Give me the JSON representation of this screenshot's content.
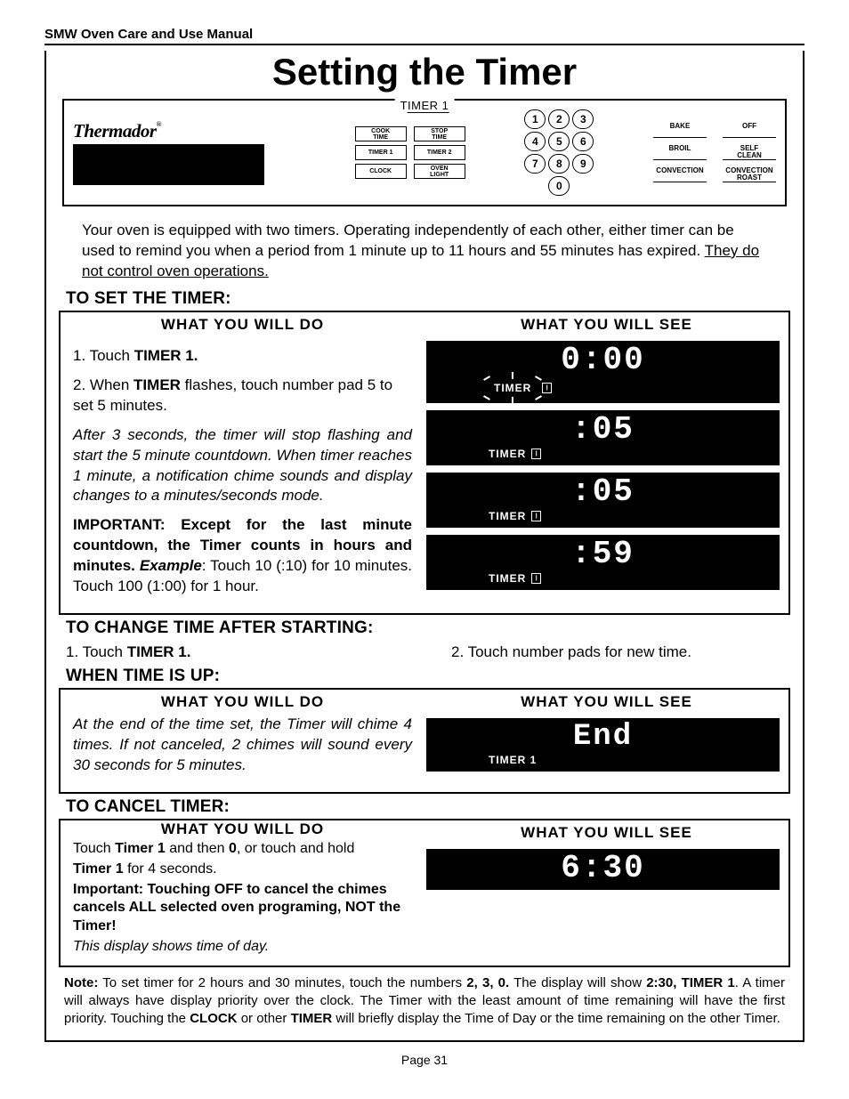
{
  "header": {
    "running": "SMW Oven Care and Use Manual"
  },
  "title": "Setting the Timer",
  "panel": {
    "tab": "TIMER 1",
    "brand": "Thermador",
    "left_buttons": [
      [
        "COOK",
        "TIME"
      ],
      [
        "STOP",
        "TIME"
      ],
      [
        "TIMER 1",
        ""
      ],
      [
        "TIMER 2",
        ""
      ],
      [
        "CLOCK",
        ""
      ],
      [
        "OVEN",
        "LIGHT"
      ]
    ],
    "keypad": [
      "1",
      "2",
      "3",
      "4",
      "5",
      "6",
      "7",
      "8",
      "9",
      "0"
    ],
    "mode_buttons": [
      "BAKE",
      "OFF",
      "BROIL",
      "SELF\nCLEAN",
      "CONVECTION",
      "CONVECTION\nROAST"
    ]
  },
  "intro": {
    "text_a": "Your oven is equipped with two timers.  Operating independently of each other, either timer can be used to remind you when a period from 1 minute up to 11 hours and 55 minutes has expired.  ",
    "text_b": "They do not control oven operations."
  },
  "set": {
    "heading": "TO SET  THE TIMER:",
    "col_do": "WHAT  YOU  WILL  DO",
    "col_see": "WHAT  YOU  WILL  SEE",
    "step1_a": "1.  Touch ",
    "step1_b": "TIMER 1.",
    "step2_a": "2.  When ",
    "step2_b": "TIMER",
    "step2_c": "  flashes, touch number pad 5 to set 5 minutes.",
    "ital": "After 3 seconds, the timer will stop flashing and start the 5 minute countdown.   When timer reaches 1 minute, a notification chime sounds and display changes to a minutes/seconds mode.",
    "imp_lead": "IMPORTANT:  Except for the last minute countdown, the Timer counts in hours and minutes. ",
    "imp_ex_lbl": "Example",
    "imp_tail": ": Touch 10 (:10) for 10 minutes. Touch 100 (1:00) for 1 hour.",
    "lcd": [
      {
        "big": "0:00",
        "sub": "TIMER",
        "flash": true,
        "icon": true
      },
      {
        "big": ":05",
        "sub": "TIMER",
        "flash": false,
        "icon": true
      },
      {
        "big": ":05",
        "sub": "TIMER",
        "flash": false,
        "icon": true
      },
      {
        "big": ":59",
        "sub": "TIMER",
        "flash": false,
        "icon": true
      }
    ]
  },
  "change": {
    "heading": "TO CHANGE TIME AFTER STARTING:",
    "left_a": "1.  Touch ",
    "left_b": "TIMER 1.",
    "right": "2.  Touch number pads for new time."
  },
  "up": {
    "heading": "WHEN TIME IS UP:",
    "col_do": "WHAT  YOU  WILL  DO",
    "col_see": "WHAT  YOU  WILL  SEE",
    "body": "At the end of the time set, the Timer will  chime 4 times.  If not canceled, 2 chimes will sound every 30 seconds for 5 minutes.",
    "lcd_big": "End",
    "lcd_sub": "TIMER   1"
  },
  "cancel": {
    "heading": "TO CANCEL TIMER:",
    "col_do": "WHAT  YOU  WILL  DO",
    "col_see": "WHAT  YOU  WILL  SEE",
    "l1_a": "Touch ",
    "l1_b": "Timer 1",
    "l1_c": " and then ",
    "l1_d": "0",
    "l1_e": ", or touch and hold ",
    "l2_a": "Timer 1",
    "l2_b": " for 4 seconds.",
    "imp": "Important:  Touching OFF to cancel the chimes cancels  ALL selected oven programing, NOT the Timer!",
    "tail": "This display shows time of day.",
    "lcd_big": "6:30"
  },
  "note": {
    "lead": "Note:",
    "a": " To set timer for 2 hours and 30 minutes, touch the numbers ",
    "b1": "2, 3, 0.",
    "c": "  The display will show ",
    "b2": "2:30, TIMER 1",
    "d": ".  A timer will always have display priority over the clock.  The Timer with the least amount of time remaining will have the first priority.  Touching the ",
    "b3": "CLOCK",
    "e": " or other ",
    "b4": "TIMER",
    "f": " will briefly display the Time of Day or the time remaining on the other Timer."
  },
  "pagenum": "Page 31"
}
